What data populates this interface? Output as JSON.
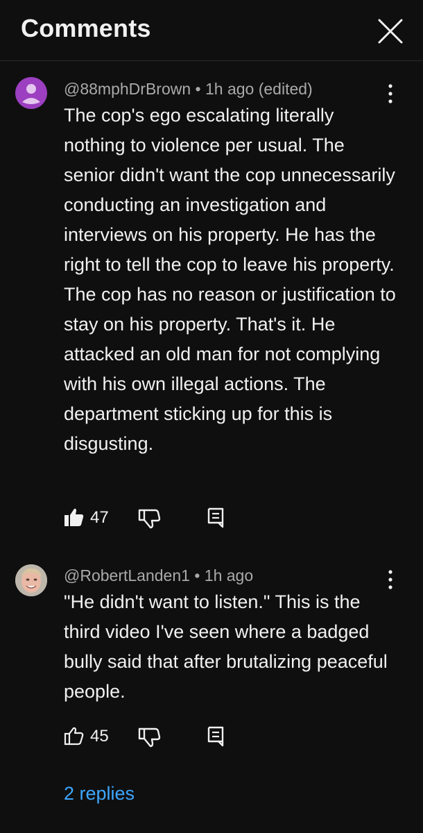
{
  "header": {
    "title": "Comments"
  },
  "comments": [
    {
      "author": "@88mphDrBrown",
      "separator": "•",
      "time": "1h ago (edited)",
      "text": "The cop's ego escalating literally nothing to violence per usual. The senior didn't want the cop unnecessarily conducting an investigation and interviews on his property. He has the right to tell the cop to leave his property. The cop has no reason or justification to stay on his property. That's it. He attacked an old man for not complying with his own illegal actions. The department sticking up for this is disgusting.",
      "likes": "47",
      "liked": true,
      "avatar_color": "#9c3fc0"
    },
    {
      "author": "@RobertLanden1",
      "separator": "•",
      "time": "1h ago",
      "text": "\"He didn't want to listen.\" This is the third video I've seen where a badged bully said that after brutalizing peaceful people.",
      "likes": "45",
      "liked": false
    }
  ],
  "replies_link": "2 replies",
  "colors": {
    "background": "#0f0f0f",
    "text": "#f1f1f1",
    "meta": "#aaaaaa",
    "link": "#3ea6ff"
  }
}
